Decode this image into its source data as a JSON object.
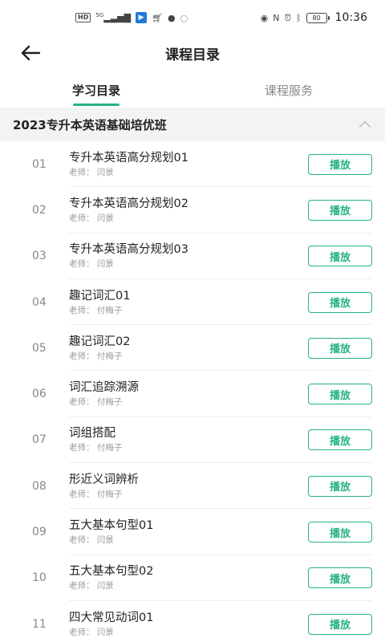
{
  "status_bar": {
    "left_icons": [
      "hd-icon",
      "signal-5g-icon",
      "app-icon",
      "cart-icon",
      "badge-icon",
      "chat-icon"
    ],
    "hd_text": "HD",
    "network_text": "5G",
    "battery_text": "80",
    "time": "10:36"
  },
  "header": {
    "title": "课程目录"
  },
  "tabs": [
    {
      "label": "学习目录",
      "active": true
    },
    {
      "label": "课程服务",
      "active": false
    }
  ],
  "section": {
    "title": "2023专升本英语基础培优班"
  },
  "teacher_prefix": "老师：",
  "play_label": "播放",
  "lessons": [
    {
      "num": "01",
      "title": "专升本英语高分规划01",
      "teacher": "老师：  闫景"
    },
    {
      "num": "02",
      "title": "专升本英语高分规划02",
      "teacher": "老师：  闫景"
    },
    {
      "num": "03",
      "title": "专升本英语高分规划03",
      "teacher": "老师：  闫景"
    },
    {
      "num": "04",
      "title": "趣记词汇01",
      "teacher": "老师：  付梅子"
    },
    {
      "num": "05",
      "title": "趣记词汇02",
      "teacher": "老师：  付梅子"
    },
    {
      "num": "06",
      "title": "词汇追踪溯源",
      "teacher": "老师：  付梅子"
    },
    {
      "num": "07",
      "title": "词组搭配",
      "teacher": "老师：  付梅子"
    },
    {
      "num": "08",
      "title": "形近义词辨析",
      "teacher": "老师：  付梅子"
    },
    {
      "num": "09",
      "title": "五大基本句型01",
      "teacher": "老师：  闫景"
    },
    {
      "num": "10",
      "title": "五大基本句型02",
      "teacher": "老师：  闫景"
    },
    {
      "num": "11",
      "title": "四大常见动词01",
      "teacher": "老师：  闫景"
    }
  ],
  "colors": {
    "accent": "#25b37f",
    "section_bg": "#f2f3f5"
  }
}
